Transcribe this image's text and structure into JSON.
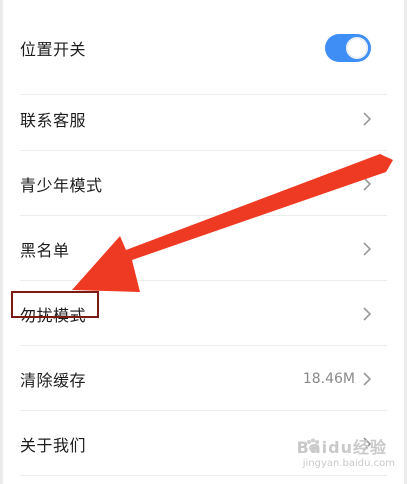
{
  "settings": {
    "items": [
      {
        "label": "位置开关",
        "type": "toggle",
        "on": true
      },
      {
        "label": "联系客服",
        "type": "link"
      },
      {
        "label": "青少年模式",
        "type": "link"
      },
      {
        "label": "黑名单",
        "type": "link"
      },
      {
        "label": "勿扰模式",
        "type": "link",
        "highlighted": true
      },
      {
        "label": "清除缓存",
        "type": "link",
        "value": "18.46M"
      },
      {
        "label": "关于我们",
        "type": "link"
      }
    ]
  },
  "colors": {
    "toggle_on": "#3f8ef5",
    "arrow": "#ee3a22",
    "highlight_box": "#7a1b14"
  },
  "icons": {
    "chevron": "chevron-right-icon",
    "arrow": "red-arrow-annotation"
  },
  "watermark": {
    "brand": "Baidu经验",
    "url": "jingyan.baidu.com"
  }
}
